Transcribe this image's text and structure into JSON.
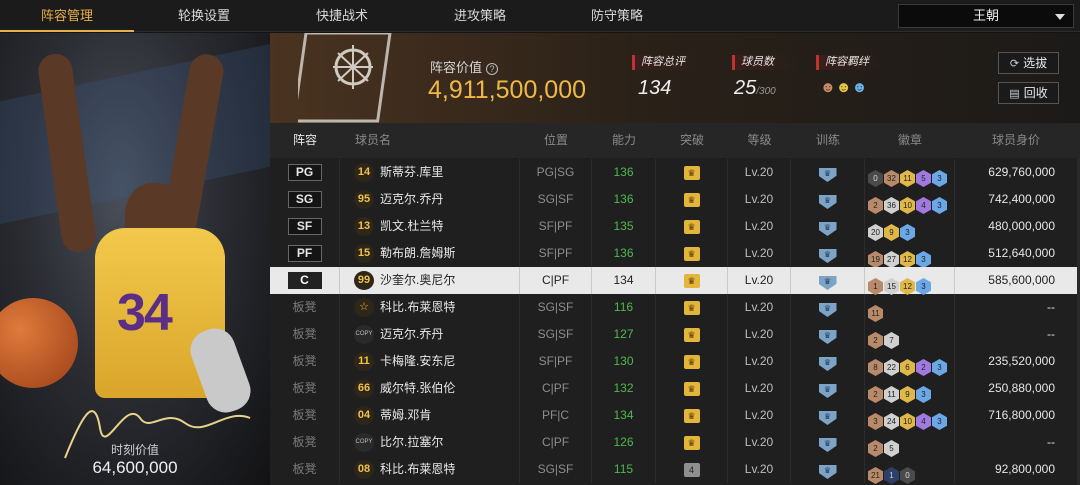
{
  "nav": {
    "tabs": [
      {
        "label": "阵容管理",
        "active": true
      },
      {
        "label": "轮换设置"
      },
      {
        "label": "快捷战术"
      },
      {
        "label": "进攻策略"
      },
      {
        "label": "防守策略"
      }
    ],
    "team_select": "王朝"
  },
  "hero": {
    "jersey_number": "34",
    "value_label": "时刻价值",
    "value": "64,600,000"
  },
  "summary": {
    "logo_text": "PHOENIX SUNS",
    "lineup_value_label": "阵容价值",
    "lineup_value": "4,911,500,000",
    "rating_label": "阵容总评",
    "rating": "134",
    "count_label": "球员数",
    "count": "25",
    "count_max": "/300",
    "bond_label": "阵容羁绊",
    "select_button": "选拔",
    "recycle_button": "回收"
  },
  "table": {
    "headers": [
      "阵容",
      "球员名",
      "位置",
      "能力",
      "突破",
      "等级",
      "训练",
      "徽章",
      "球员身价"
    ],
    "rows": [
      {
        "slot": "PG",
        "starter": true,
        "jersey": "14",
        "name": "斯蒂芬.库里",
        "pos": "PG|SG",
        "ability": "136",
        "break": "crown",
        "level": "Lv.20",
        "badges": [
          [
            "0",
            "dark"
          ],
          [
            "32",
            "bronze"
          ],
          [
            "11",
            "gold"
          ],
          [
            "5",
            "purple"
          ],
          [
            "3",
            "blue"
          ]
        ],
        "salary": "629,760,000"
      },
      {
        "slot": "SG",
        "starter": true,
        "jersey": "95",
        "name": "迈克尔.乔丹",
        "pos": "SG|SF",
        "ability": "136",
        "break": "crown",
        "level": "Lv.20",
        "badges": [
          [
            "2",
            "bronze"
          ],
          [
            "36",
            "silver"
          ],
          [
            "10",
            "gold"
          ],
          [
            "4",
            "purple"
          ],
          [
            "3",
            "blue"
          ]
        ],
        "salary": "742,400,000"
      },
      {
        "slot": "SF",
        "starter": true,
        "jersey": "13",
        "name": "凯文.杜兰特",
        "pos": "SF|PF",
        "ability": "135",
        "break": "crown",
        "level": "Lv.20",
        "badges": [
          [
            "20",
            "silver"
          ],
          [
            "9",
            "gold"
          ],
          [
            "3",
            "blue"
          ]
        ],
        "salary": "480,000,000"
      },
      {
        "slot": "PF",
        "starter": true,
        "jersey": "15",
        "name": "勒布朗.詹姆斯",
        "pos": "SF|PF",
        "ability": "136",
        "break": "crown",
        "level": "Lv.20",
        "badges": [
          [
            "19",
            "bronze"
          ],
          [
            "27",
            "silver"
          ],
          [
            "12",
            "gold"
          ],
          [
            "3",
            "blue"
          ]
        ],
        "salary": "512,640,000"
      },
      {
        "slot": "C",
        "starter": true,
        "selected": true,
        "jersey": "99",
        "name": "沙奎尔.奥尼尔",
        "pos": "C|PF",
        "ability": "134",
        "break": "crown",
        "level": "Lv.20",
        "badges": [
          [
            "1",
            "bronze"
          ],
          [
            "15",
            "silver"
          ],
          [
            "12",
            "gold"
          ],
          [
            "3",
            "blue"
          ]
        ],
        "salary": "585,600,000"
      },
      {
        "slot": "板凳",
        "jersey": "☆",
        "name": "科比.布莱恩特",
        "pos": "SG|SF",
        "ability": "116",
        "break": "crown",
        "level": "Lv.20",
        "badges": [
          [
            "11",
            "bronze"
          ]
        ],
        "salary": "--"
      },
      {
        "slot": "板凳",
        "jersey": "COPY",
        "copy": true,
        "name": "迈克尔.乔丹",
        "pos": "SG|SF",
        "ability": "127",
        "break": "crown",
        "level": "Lv.20",
        "badges": [
          [
            "2",
            "bronze"
          ],
          [
            "7",
            "silver"
          ]
        ],
        "salary": "--"
      },
      {
        "slot": "板凳",
        "jersey": "11",
        "name": "卡梅隆.安东尼",
        "pos": "SF|PF",
        "ability": "130",
        "break": "crown",
        "level": "Lv.20",
        "badges": [
          [
            "8",
            "bronze"
          ],
          [
            "22",
            "silver"
          ],
          [
            "6",
            "gold"
          ],
          [
            "2",
            "purple"
          ],
          [
            "3",
            "blue"
          ]
        ],
        "salary": "235,520,000"
      },
      {
        "slot": "板凳",
        "jersey": "66",
        "name": "威尔特.张伯伦",
        "pos": "C|PF",
        "ability": "132",
        "break": "crown",
        "level": "Lv.20",
        "badges": [
          [
            "2",
            "bronze"
          ],
          [
            "11",
            "silver"
          ],
          [
            "9",
            "gold"
          ],
          [
            "3",
            "blue"
          ]
        ],
        "salary": "250,880,000"
      },
      {
        "slot": "板凳",
        "jersey": "04",
        "name": "蒂姆.邓肯",
        "pos": "PF|C",
        "ability": "134",
        "break": "crown",
        "level": "Lv.20",
        "badges": [
          [
            "3",
            "bronze"
          ],
          [
            "24",
            "silver"
          ],
          [
            "10",
            "gold"
          ],
          [
            "4",
            "purple"
          ],
          [
            "3",
            "blue"
          ]
        ],
        "salary": "716,800,000"
      },
      {
        "slot": "板凳",
        "jersey": "COPY",
        "copy": true,
        "name": "比尔.拉塞尔",
        "pos": "C|PF",
        "ability": "126",
        "break": "crown",
        "level": "Lv.20",
        "badges": [
          [
            "2",
            "bronze"
          ],
          [
            "5",
            "silver"
          ]
        ],
        "salary": "--"
      },
      {
        "slot": "板凳",
        "jersey": "08",
        "name": "科比.布莱恩特",
        "pos": "SG|SF",
        "ability": "115",
        "break": "4",
        "level": "Lv.20",
        "badges": [
          [
            "21",
            "bronze"
          ],
          [
            "1",
            "navy"
          ],
          [
            "0",
            "dark"
          ]
        ],
        "salary": "92,800,000"
      }
    ]
  }
}
